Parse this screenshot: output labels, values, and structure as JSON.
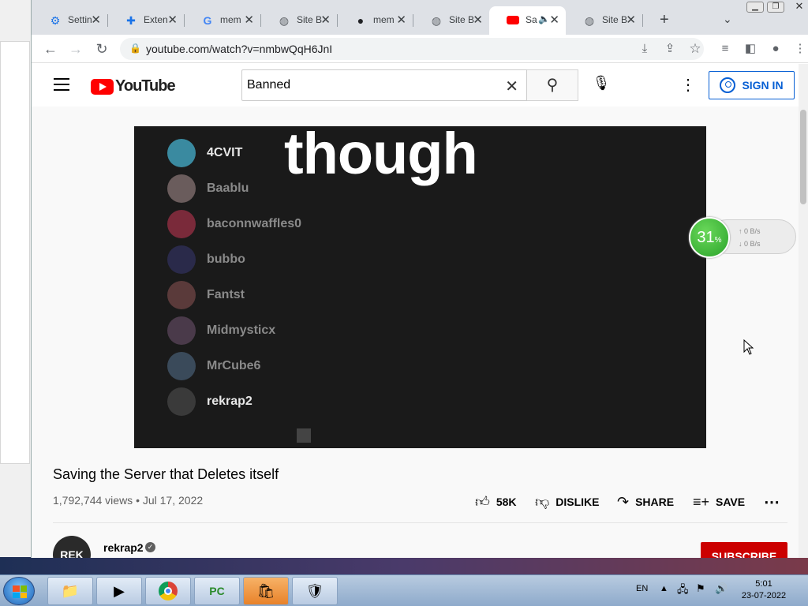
{
  "browser": {
    "tabs": [
      {
        "label": "Settin",
        "icon": "gear-icon",
        "active": false
      },
      {
        "label": "Exten",
        "icon": "puzzle-icon",
        "active": false
      },
      {
        "label": "mem",
        "icon": "google-icon",
        "active": false
      },
      {
        "label": "Site B",
        "icon": "globe-icon",
        "active": false
      },
      {
        "label": "mem",
        "icon": "github-icon",
        "active": false
      },
      {
        "label": "Site B",
        "icon": "globe-icon",
        "active": false
      },
      {
        "label": "Sa",
        "icon": "youtube-icon",
        "active": true
      },
      {
        "label": "Site B",
        "icon": "globe-icon",
        "active": false
      }
    ],
    "url": "youtube.com/watch?v=nmbwQqH6JnI"
  },
  "youtube": {
    "logo_text": "YouTube",
    "search_value": "Banned",
    "sign_in_label": "SIGN IN",
    "video": {
      "overlay_text": "though",
      "members": [
        "4CVIT",
        "Baablu",
        "baconnwaffles0",
        "bubbo",
        "Fantst",
        "Midmysticx",
        "MrCube6",
        "rekrap2"
      ]
    },
    "title": "Saving the Server that Deletes itself",
    "meta": "1,792,744 views • Jul 17, 2022",
    "actions": {
      "like": "58K",
      "dislike": "DISLIKE",
      "share": "SHARE",
      "save": "SAVE"
    },
    "channel": {
      "name": "rekrap2",
      "avatar_text": "REK",
      "subscribe": "SUBSCRIBE"
    }
  },
  "net_meter": {
    "percent": "31",
    "percent_sign": "%",
    "up": "0 B/s",
    "down": "0 B/s"
  },
  "taskbar": {
    "lang": "EN",
    "time": "5:01",
    "date": "23-07-2022"
  },
  "colors": {
    "accent": "#065fd4",
    "youtube_red": "#ff0000",
    "subscribe_red": "#cc0000"
  }
}
